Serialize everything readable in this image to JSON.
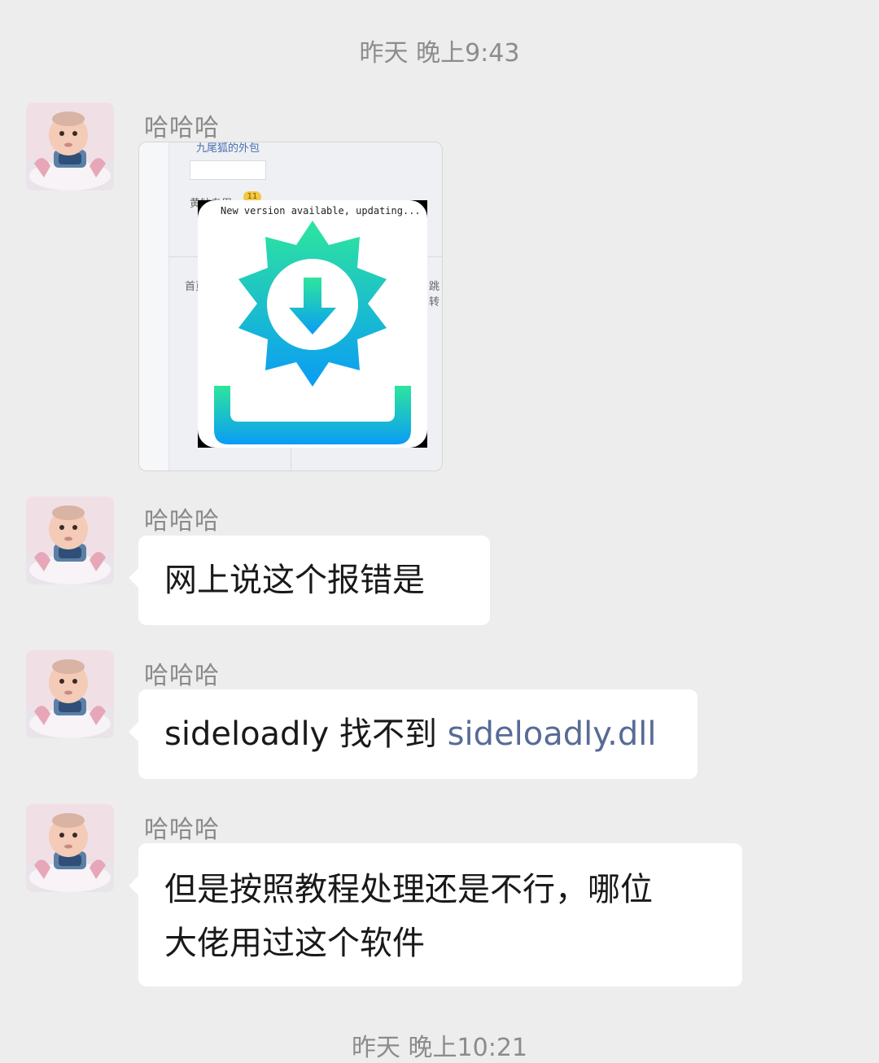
{
  "timestamps": [
    "昨天 晚上9:43",
    "昨天 晚上10:21"
  ],
  "messages": [
    {
      "sender": "哈哈哈",
      "type": "image",
      "image": {
        "popup_text": "New version available, updating...",
        "bg_text_top": "九尾狐的外包",
        "bg_text_tab": "黄钻专用",
        "bg_badge": "11",
        "bg_text_nav_left": "首页",
        "bg_text_nav_right": "跳转",
        "icon": "gear-download-icon",
        "gradient_colors": [
          "#2ee59d",
          "#0a9cf5"
        ]
      }
    },
    {
      "sender": "哈哈哈",
      "type": "text",
      "text": "网上说这个报错是"
    },
    {
      "sender": "哈哈哈",
      "type": "text",
      "text_prefix": "sideloadly 找不到 ",
      "link_text": "sideloadly.dll"
    },
    {
      "sender": "哈哈哈",
      "type": "text",
      "lines": [
        "但是按照教程处理还是不行，哪位",
        "大佬用过这个软件"
      ]
    }
  ],
  "colors": {
    "background": "#ededed",
    "bubble": "#ffffff",
    "link": "#576b95",
    "timestamp": "#8c8c8c"
  }
}
